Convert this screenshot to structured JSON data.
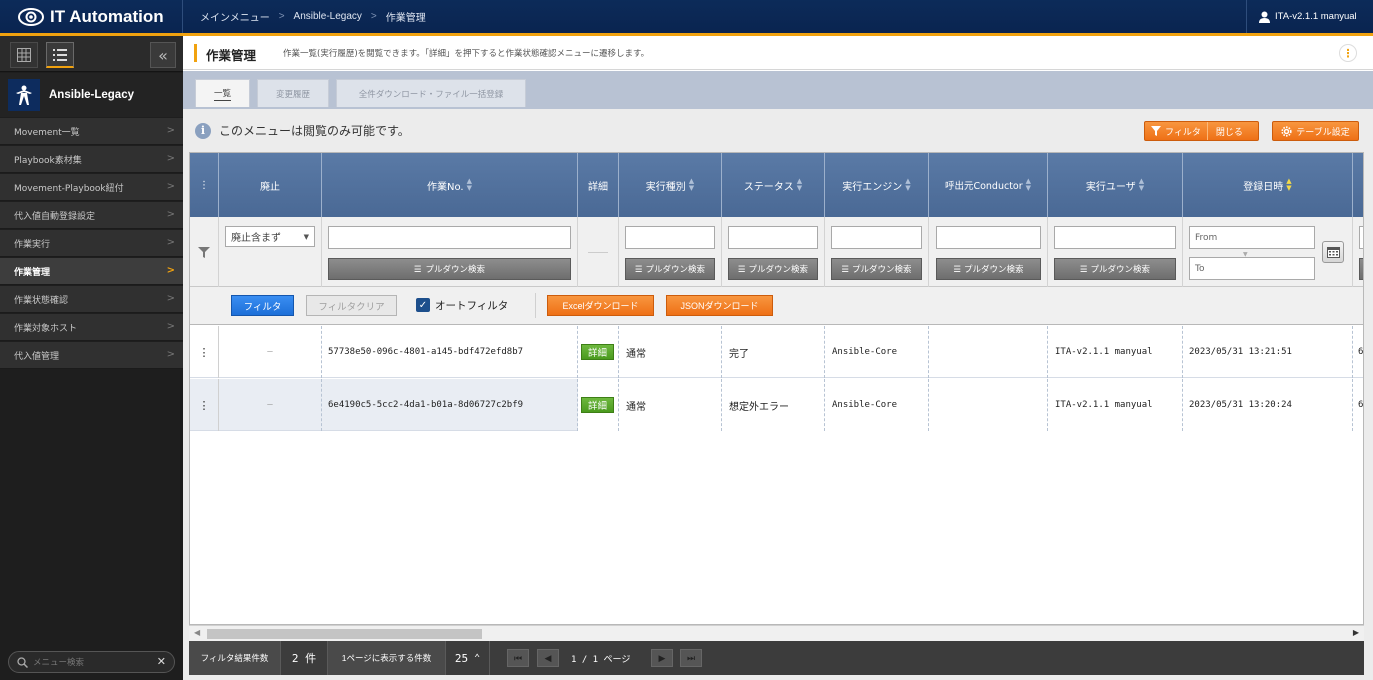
{
  "app": {
    "title": "IT Automation"
  },
  "breadcrumb": [
    "メインメニュー",
    "Ansible-Legacy",
    "作業管理"
  ],
  "user": {
    "name": "ITA-v2.1.1 manyual"
  },
  "sidebar": {
    "menu_group": "Ansible-Legacy",
    "items": [
      {
        "label": "Movement一覧"
      },
      {
        "label": "Playbook素材集"
      },
      {
        "label": "Movement-Playbook紐付"
      },
      {
        "label": "代入値自動登録設定"
      },
      {
        "label": "作業実行"
      },
      {
        "label": "作業管理"
      },
      {
        "label": "作業状態確認"
      },
      {
        "label": "作業対象ホスト"
      },
      {
        "label": "代入値管理"
      }
    ],
    "active_index": 5,
    "search_placeholder": "メニュー検索"
  },
  "page": {
    "title": "作業管理",
    "description": "作業一覧(実行履歴)を閲覧できます。「詳細」を押下すると作業状態確認メニューに遷移します。",
    "tabs": [
      {
        "label": "一覧",
        "active": true
      },
      {
        "label": "変更履歴",
        "active": false
      },
      {
        "label": "全件ダウンロード・ファイル一括登録",
        "active": false
      }
    ],
    "info": "このメニューは閲覧のみ可能です。",
    "filter_toggle": {
      "label": "フィルタ",
      "close_label": "閉じる"
    },
    "table_settings_label": "テーブル設定"
  },
  "table": {
    "columns": [
      {
        "label": "廃止",
        "sortable": false
      },
      {
        "label": "作業No.",
        "sortable": true
      },
      {
        "label": "詳細",
        "sortable": false
      },
      {
        "label": "実行種別",
        "sortable": true
      },
      {
        "label": "ステータス",
        "sortable": true
      },
      {
        "label": "実行エンジン",
        "sortable": true
      },
      {
        "label": "呼出元Conductor",
        "sortable": true
      },
      {
        "label": "実行ユーザ",
        "sortable": true
      },
      {
        "label": "登録日時",
        "sortable": true,
        "sorted": true
      }
    ],
    "filter": {
      "discard_select": "廃止含まず",
      "pulldown_label": "プルダウン検索",
      "from_placeholder": "From",
      "to_placeholder": "To",
      "filter_button": "フィルタ",
      "clear_button": "フィルタクリア",
      "auto_filter_label": "オートフィルタ",
      "auto_filter_checked": true,
      "excel_button": "Excelダウンロード",
      "json_button": "JSONダウンロード"
    },
    "detail_label": "詳細",
    "discard_mark": "—",
    "rows": [
      {
        "id": "57738e50-096c-4801-a145-bdf472efd8b7",
        "exec_type": "通常",
        "status": "完了",
        "engine": "Ansible-Core",
        "conductor": "",
        "user": "ITA-v2.1.1 manyual",
        "registered": "2023/05/31 13:21:51",
        "next": "6"
      },
      {
        "id": "6e4190c5-5cc2-4da1-b01a-8d06727c2bf9",
        "exec_type": "通常",
        "status": "想定外エラー",
        "engine": "Ansible-Core",
        "conductor": "",
        "user": "ITA-v2.1.1 manyual",
        "registered": "2023/05/31 13:20:24",
        "next": "6"
      }
    ]
  },
  "footer": {
    "filter_count_label": "フィルタ結果件数",
    "filter_count": "2 件",
    "per_page_label": "1ページに表示する件数",
    "per_page": "25",
    "page_info": "1 / 1 ページ"
  },
  "colors": {
    "header_bg": "#0c2b59",
    "accent": "#f1a20f",
    "table_header": "#4f6f9c",
    "detail_green": "#5aaa2a",
    "orange": "#f08020",
    "blue_btn": "#2a7be0"
  }
}
